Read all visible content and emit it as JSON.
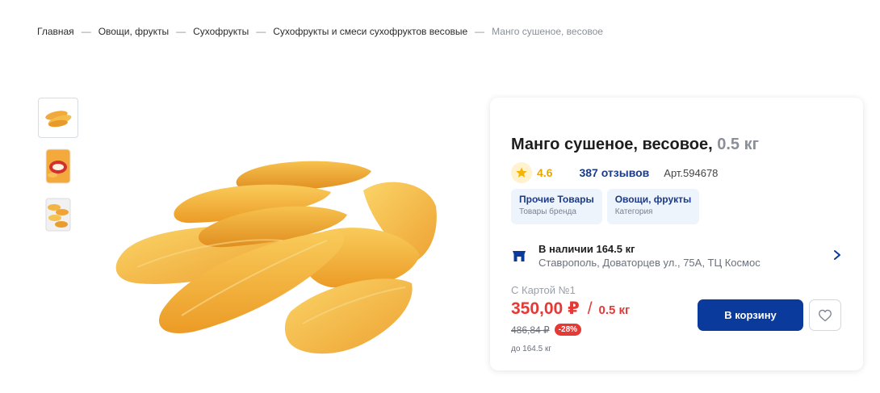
{
  "breadcrumb": {
    "items": [
      "Главная",
      "Овощи, фрукты",
      "Сухофрукты",
      "Сухофрукты и смеси сухофруктов весовые"
    ],
    "current": "Манго сушеное, весовое",
    "separator": "—"
  },
  "gallery": {
    "thumbnails": [
      "mango-pieces-image",
      "mango-package-image",
      "mango-tray-image"
    ],
    "main_image": "dried-mango-image"
  },
  "product": {
    "title": "Манго сушеное, весовое,",
    "weight": "0.5 кг",
    "rating": "4.6",
    "reviews": "387 отзывов",
    "article": "Арт.594678",
    "tags": [
      {
        "title": "Прочие Товары",
        "subtitle": "Товары бренда"
      },
      {
        "title": "Овощи, фрукты",
        "subtitle": "Категория"
      }
    ],
    "availability": {
      "title": "В наличии 164.5 кг",
      "address": "Ставрополь, Доваторцев ул., 75А, ТЦ Космос"
    },
    "card_label": "С Картой №1",
    "price": "350,00 ₽",
    "price_separator": "/",
    "unit": "0.5 кг",
    "old_price": "486,84 ₽",
    "discount": "-28%",
    "limit": "до 164.5 кг",
    "cart_button": "В корзину"
  },
  "colors": {
    "accent": "#0a3a9c",
    "price": "#e53935",
    "star": "#f5b400",
    "tag_bg": "#eef4fc"
  }
}
